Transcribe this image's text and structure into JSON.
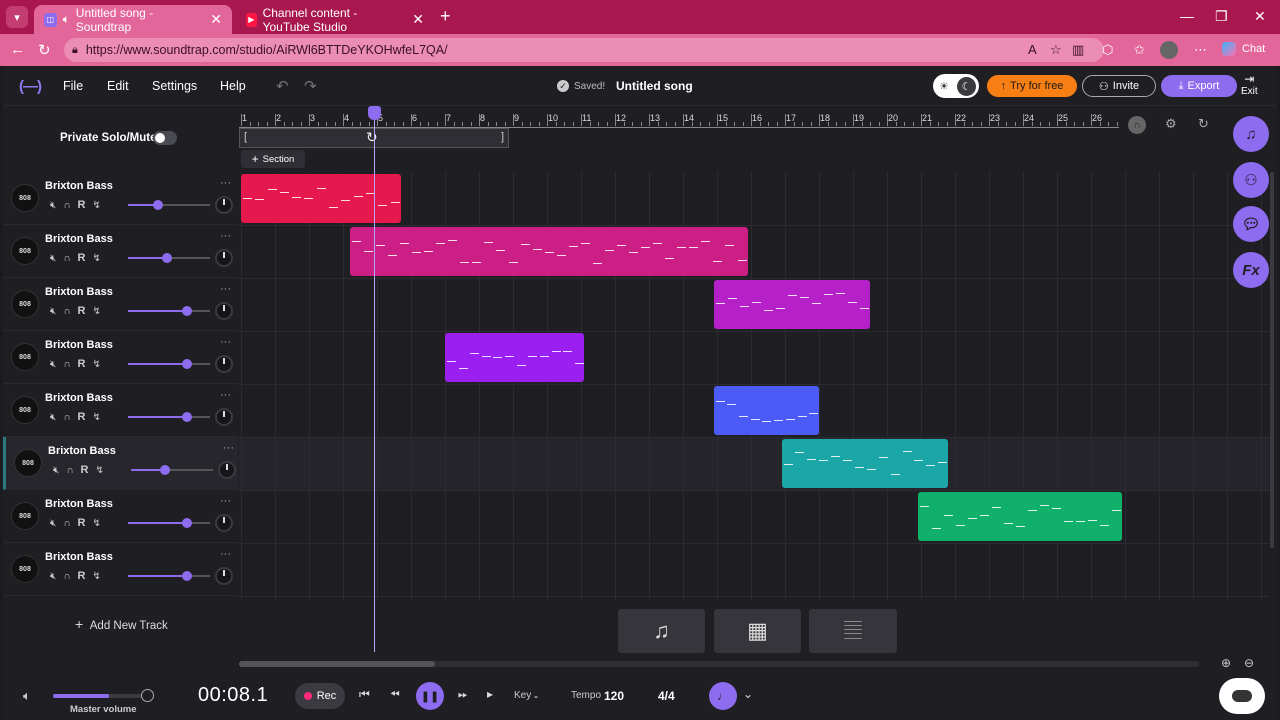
{
  "browser": {
    "tabs": [
      {
        "label": "Untitled song - Soundtrap",
        "active": true
      },
      {
        "label": "Channel content - YouTube Studio",
        "active": false
      }
    ],
    "url": "https://www.soundtrap.com/studio/AiRWl6BTTDeYKOHwfeL7QA/",
    "chat_label": "Chat"
  },
  "app": {
    "menu": {
      "file": "File",
      "edit": "Edit",
      "settings": "Settings",
      "help": "Help"
    },
    "saved_status": "Saved!",
    "song_title": "Untitled song",
    "try_label": "Try for free",
    "invite_label": "Invite",
    "export_label": "Export",
    "exit_label": "Exit",
    "private_solo_label": "Private Solo/Mute",
    "section_label": "Section",
    "add_track_label": "Add New Track"
  },
  "ruler": {
    "bars": [
      "1",
      "2",
      "3",
      "4",
      "5",
      "6",
      "7",
      "8",
      "9",
      "10",
      "11",
      "12",
      "13",
      "14",
      "15",
      "16",
      "17",
      "18",
      "19",
      "20",
      "21",
      "22",
      "23",
      "24",
      "25",
      "26"
    ]
  },
  "tracks": [
    {
      "name": "Brixton Bass",
      "instrument": "808",
      "volume": 0.37,
      "selected": false
    },
    {
      "name": "Brixton Bass",
      "instrument": "808",
      "volume": 0.47,
      "selected": false
    },
    {
      "name": "Brixton Bass",
      "instrument": "808",
      "volume": 0.72,
      "selected": false
    },
    {
      "name": "Brixton Bass",
      "instrument": "808",
      "volume": 0.72,
      "selected": false
    },
    {
      "name": "Brixton Bass",
      "instrument": "808",
      "volume": 0.72,
      "selected": false
    },
    {
      "name": "Brixton Bass",
      "instrument": "808",
      "volume": 0.42,
      "selected": true
    },
    {
      "name": "Brixton Bass",
      "instrument": "808",
      "volume": 0.72,
      "selected": false
    },
    {
      "name": "Brixton Bass",
      "instrument": "808",
      "volume": 0.72,
      "selected": false
    }
  ],
  "clips": [
    {
      "track": 0,
      "start_bar": 1.0,
      "end_bar": 5.7,
      "color": "#e5194e"
    },
    {
      "track": 1,
      "start_bar": 4.2,
      "end_bar": 15.9,
      "color": "#cc1f86"
    },
    {
      "track": 2,
      "start_bar": 14.9,
      "end_bar": 19.5,
      "color": "#b620c9"
    },
    {
      "track": 3,
      "start_bar": 7.0,
      "end_bar": 11.1,
      "color": "#9b1ff0"
    },
    {
      "track": 4,
      "start_bar": 14.9,
      "end_bar": 18.0,
      "color": "#4a5cf5"
    },
    {
      "track": 5,
      "start_bar": 16.9,
      "end_bar": 21.8,
      "color": "#1ba6a8"
    },
    {
      "track": 6,
      "start_bar": 20.9,
      "end_bar": 26.9,
      "color": "#10b06a"
    }
  ],
  "transport": {
    "master_volume_label": "Master volume",
    "master_volume": 0.6,
    "time": "00:08.1",
    "rec_label": "Rec",
    "key_label": "Key",
    "key_value": "-",
    "tempo_label": "Tempo",
    "tempo_value": "120",
    "time_signature": "4/4"
  },
  "colors": {
    "accent": "#8e6cf0",
    "try_button": "#f77f13",
    "browser_tab": "#a8174e"
  },
  "icons": [
    "undo-icon",
    "redo-icon",
    "sun-icon",
    "moon-icon",
    "headphones-icon",
    "gear-icon",
    "refresh-icon",
    "music-note-icon",
    "collaborators-icon",
    "chat-bubble-icon",
    "fx-icon",
    "loops-icon",
    "piano-icon",
    "speaker-icon",
    "metronome-icon"
  ]
}
